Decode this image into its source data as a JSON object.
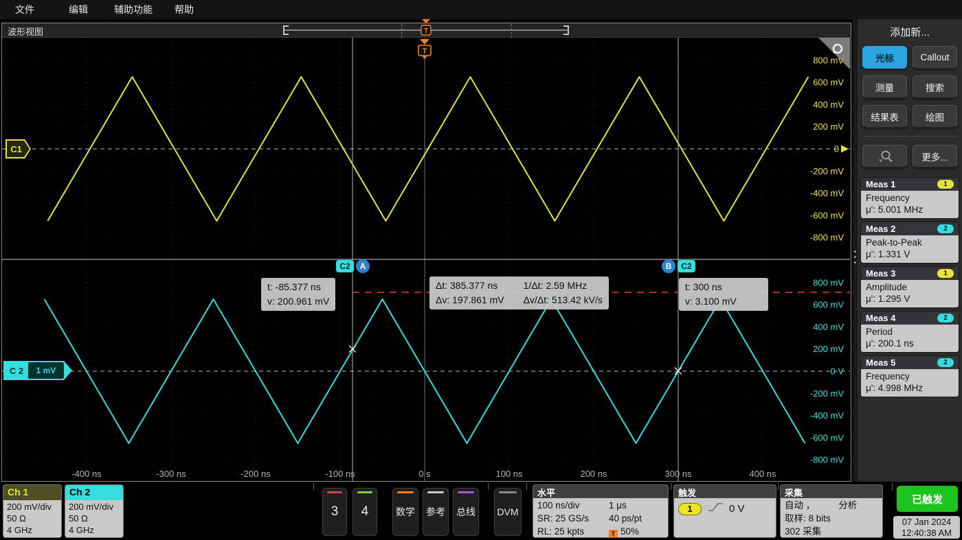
{
  "menu": {
    "items": [
      "文件",
      "编辑",
      "辅助功能",
      "帮助"
    ]
  },
  "view": {
    "title": "波形视图"
  },
  "chart_data": {
    "type": "line",
    "title": "",
    "x_axis": {
      "unit": "ns",
      "ns_per_div": 100,
      "record_ns": 1000,
      "ticks": [
        {
          "t_ns": -400,
          "label": "-400 ns"
        },
        {
          "t_ns": -300,
          "label": "-300 ns"
        },
        {
          "t_ns": -200,
          "label": "-200 ns"
        },
        {
          "t_ns": -100,
          "label": "-100 ns"
        },
        {
          "t_ns": 0,
          "label": "0 s"
        },
        {
          "t_ns": 100,
          "label": "100 ns"
        },
        {
          "t_ns": 200,
          "label": "200 ns"
        },
        {
          "t_ns": 300,
          "label": "300 ns"
        },
        {
          "t_ns": 400,
          "label": "400 ns"
        }
      ]
    },
    "panels": [
      {
        "channel": "C1",
        "color": "#e8e337",
        "badge_label": "C1",
        "y_ticks": [
          {
            "mV": 800,
            "label": "800 mV"
          },
          {
            "mV": 600,
            "label": "600 mV"
          },
          {
            "mV": 400,
            "label": "400 mV"
          },
          {
            "mV": 200,
            "label": "200 mV"
          },
          {
            "mV": 0,
            "label": "0"
          },
          {
            "mV": -200,
            "label": "-200 mV"
          },
          {
            "mV": -400,
            "label": "-400 mV"
          },
          {
            "mV": -600,
            "label": "-600 mV"
          },
          {
            "mV": -800,
            "label": "-800 mV"
          }
        ],
        "wave": {
          "shape": "triangle",
          "amplitude_mV": 650,
          "period_ns": 200,
          "peak_time_ns": 54
        }
      },
      {
        "channel": "C2",
        "color": "#35dede",
        "badge_label": "C 2",
        "badge_scale": "1 mV",
        "y_ticks": [
          {
            "mV": 800,
            "label": "800 mV"
          },
          {
            "mV": 600,
            "label": "600 mV"
          },
          {
            "mV": 400,
            "label": "400 mV"
          },
          {
            "mV": 200,
            "label": "200 mV"
          },
          {
            "mV": 0,
            "label": "0 V"
          },
          {
            "mV": -200,
            "label": "-200 mV"
          },
          {
            "mV": -400,
            "label": "-400 mV"
          },
          {
            "mV": -600,
            "label": "-600 mV"
          },
          {
            "mV": -800,
            "label": "-800 mV"
          }
        ],
        "wave": {
          "shape": "triangle",
          "amplitude_mV": 650,
          "period_ns": 200,
          "peak_time_ns": -50
        }
      }
    ],
    "trigger": {
      "t_ns": 0,
      "label": "T",
      "color": "#f5821f"
    },
    "cursors": {
      "source": "C2",
      "a": {
        "label": "A",
        "t_ns": -85.377,
        "v_mV": 200.961
      },
      "b": {
        "label": "B",
        "t_ns": 300,
        "v_mV": 3.1
      },
      "readouts": {
        "a_line1": "t: -85.377 ns",
        "a_line2": "v: 200.961 mV",
        "dt": "Δt: 385.377 ns",
        "inv_dt": "1/Δt: 2.59 MHz",
        "dv": "Δv: 197.861 mV",
        "dv_dt": "Δv/Δt: 513.42 kV/s",
        "b_line1": "t: 300 ns",
        "b_line2": "v: 3.100 mV"
      }
    }
  },
  "sidebar": {
    "title": "添加新...",
    "buttons": [
      {
        "label": "光标",
        "name": "cursor",
        "active": true
      },
      {
        "label": "Callout",
        "name": "callout"
      },
      {
        "label": "测量",
        "name": "measure"
      },
      {
        "label": "搜索",
        "name": "search"
      },
      {
        "label": "结果表",
        "name": "results-table"
      },
      {
        "label": "绘图",
        "name": "plot"
      },
      {
        "label": "",
        "name": "zoom-search",
        "icon": "zoom-search-icon"
      },
      {
        "label": "更多...",
        "name": "more"
      }
    ]
  },
  "measurements": [
    {
      "name": "Meas 1",
      "source_badge": "1",
      "badge_color": "#e8e337",
      "kind": "Frequency",
      "value": "μ': 5.001 MHz"
    },
    {
      "name": "Meas 2",
      "source_badge": "2",
      "badge_color": "#35dede",
      "kind": "Peak-to-Peak",
      "value": "μ': 1.331 V"
    },
    {
      "name": "Meas 3",
      "source_badge": "1",
      "badge_color": "#e8e337",
      "kind": "Amplitude",
      "value": "μ': 1.295 V"
    },
    {
      "name": "Meas 4",
      "source_badge": "2",
      "badge_color": "#35dede",
      "kind": "Period",
      "value": "μ': 200.1 ns"
    },
    {
      "name": "Meas 5",
      "source_badge": "2",
      "badge_color": "#35dede",
      "kind": "Frequency",
      "value": "μ': 4.998 MHz"
    }
  ],
  "bottom": {
    "channels": [
      {
        "label": "Ch 1",
        "header_bg": "#4f4f26",
        "header_fg": "#e8e337",
        "lines": [
          "200 mV/div",
          "50 Ω",
          "4 GHz"
        ]
      },
      {
        "label": "Ch 2",
        "header_bg": "#35dede",
        "header_fg": "#000000",
        "lines": [
          "200 mV/div",
          "50 Ω",
          "4 GHz"
        ]
      }
    ],
    "inactive_buttons": [
      {
        "label": "3",
        "name": "channel-3",
        "stripe": "#e03a5a"
      },
      {
        "label": "4",
        "name": "channel-4",
        "stripe": "#7ed63c"
      },
      {
        "label": "数学",
        "name": "math",
        "stripe": "#f5821f"
      },
      {
        "label": "参考",
        "name": "reference",
        "stripe": "#c9c9c9"
      },
      {
        "label": "总线",
        "name": "bus",
        "stripe": "#b44fe0"
      },
      {
        "label": "DVM",
        "name": "dvm",
        "stripe": "#8a8a8a"
      }
    ],
    "horizontal": {
      "title": "水平",
      "rows": [
        [
          "100 ns/div",
          "1 μs"
        ],
        [
          "SR: 25 GS/s",
          "40 ps/pt"
        ],
        [
          "RL: 25 kpts",
          "50%"
        ]
      ]
    },
    "trigger_panel": {
      "title": "触发",
      "source": "1",
      "level": "0 V"
    },
    "acquisition": {
      "title": "采集",
      "line1_left": "自动 ，",
      "line1_right": "分析",
      "line2": "取样: 8 bits",
      "line3": "302 采集"
    },
    "status": {
      "label": "已触发",
      "color": "#1ec41e"
    },
    "datetime": {
      "date": "07 Jan 2024",
      "time": "12:40:38 AM"
    }
  }
}
